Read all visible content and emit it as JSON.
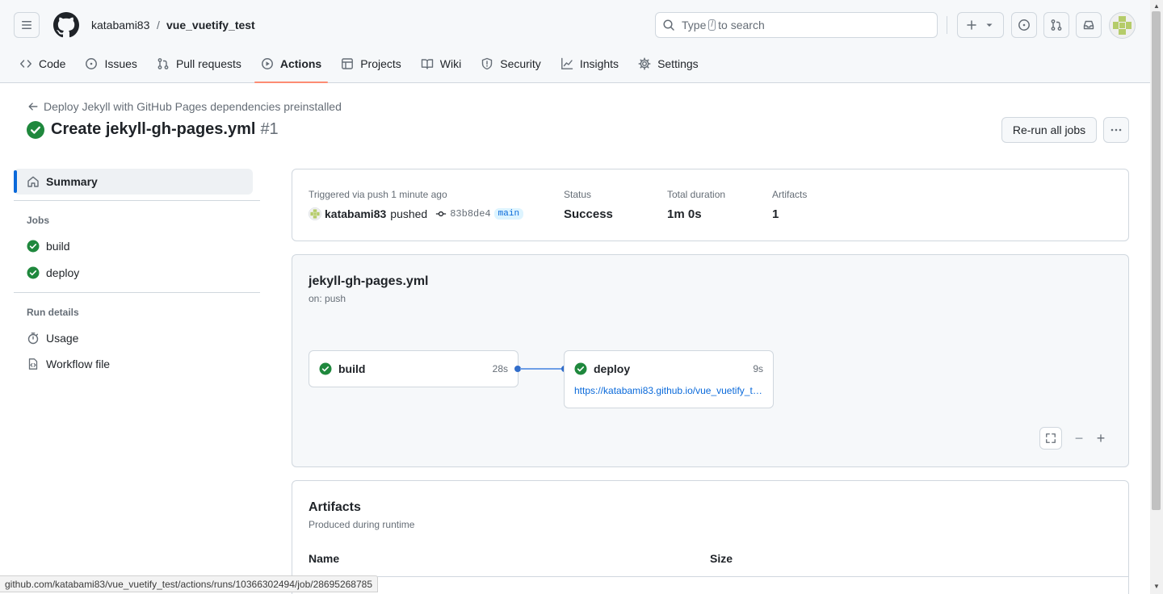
{
  "header": {
    "owner": "katabami83",
    "separator": "/",
    "repo": "vue_vuetify_test",
    "search_prefix": "Type",
    "search_key": "/",
    "search_suffix": "to search"
  },
  "tabs": [
    {
      "label": "Code",
      "icon": "code-icon"
    },
    {
      "label": "Issues",
      "icon": "issue-icon"
    },
    {
      "label": "Pull requests",
      "icon": "pull-request-icon"
    },
    {
      "label": "Actions",
      "icon": "play-icon",
      "active": true
    },
    {
      "label": "Projects",
      "icon": "table-icon"
    },
    {
      "label": "Wiki",
      "icon": "book-icon"
    },
    {
      "label": "Security",
      "icon": "shield-icon"
    },
    {
      "label": "Insights",
      "icon": "graph-icon"
    },
    {
      "label": "Settings",
      "icon": "gear-icon"
    }
  ],
  "page": {
    "back_label": "Deploy Jekyll with GitHub Pages dependencies preinstalled",
    "title": "Create jekyll-gh-pages.yml",
    "run_number": "#1",
    "rerun_label": "Re-run all jobs"
  },
  "sidebar": {
    "summary": "Summary",
    "jobs_heading": "Jobs",
    "jobs": [
      {
        "label": "build"
      },
      {
        "label": "deploy"
      }
    ],
    "run_details_heading": "Run details",
    "details": [
      {
        "label": "Usage"
      },
      {
        "label": "Workflow file"
      }
    ]
  },
  "summary": {
    "trigger": "Triggered via push 1 minute ago",
    "actor": "katabami83",
    "action": "pushed",
    "commit": "83b8de4",
    "branch": "main",
    "status_label": "Status",
    "status_value": "Success",
    "duration_label": "Total duration",
    "duration_value": "1m 0s",
    "artifacts_label": "Artifacts",
    "artifacts_value": "1"
  },
  "workflow": {
    "name": "jekyll-gh-pages.yml",
    "trigger": "on: push",
    "jobs": [
      {
        "name": "build",
        "time": "28s"
      },
      {
        "name": "deploy",
        "time": "9s",
        "link": "https://katabami83.github.io/vue_vuetify_test/"
      }
    ],
    "zoom_minus": "−",
    "zoom_plus": "+"
  },
  "artifacts": {
    "title": "Artifacts",
    "subtitle": "Produced during runtime",
    "col_name": "Name",
    "col_size": "Size"
  },
  "status_url": "github.com/katabami83/vue_vuetify_test/actions/runs/10366302494/job/28695268785",
  "colors": {
    "success": "#1f883d",
    "accent": "#0969da",
    "active_tab_underline": "#fd8c73"
  }
}
